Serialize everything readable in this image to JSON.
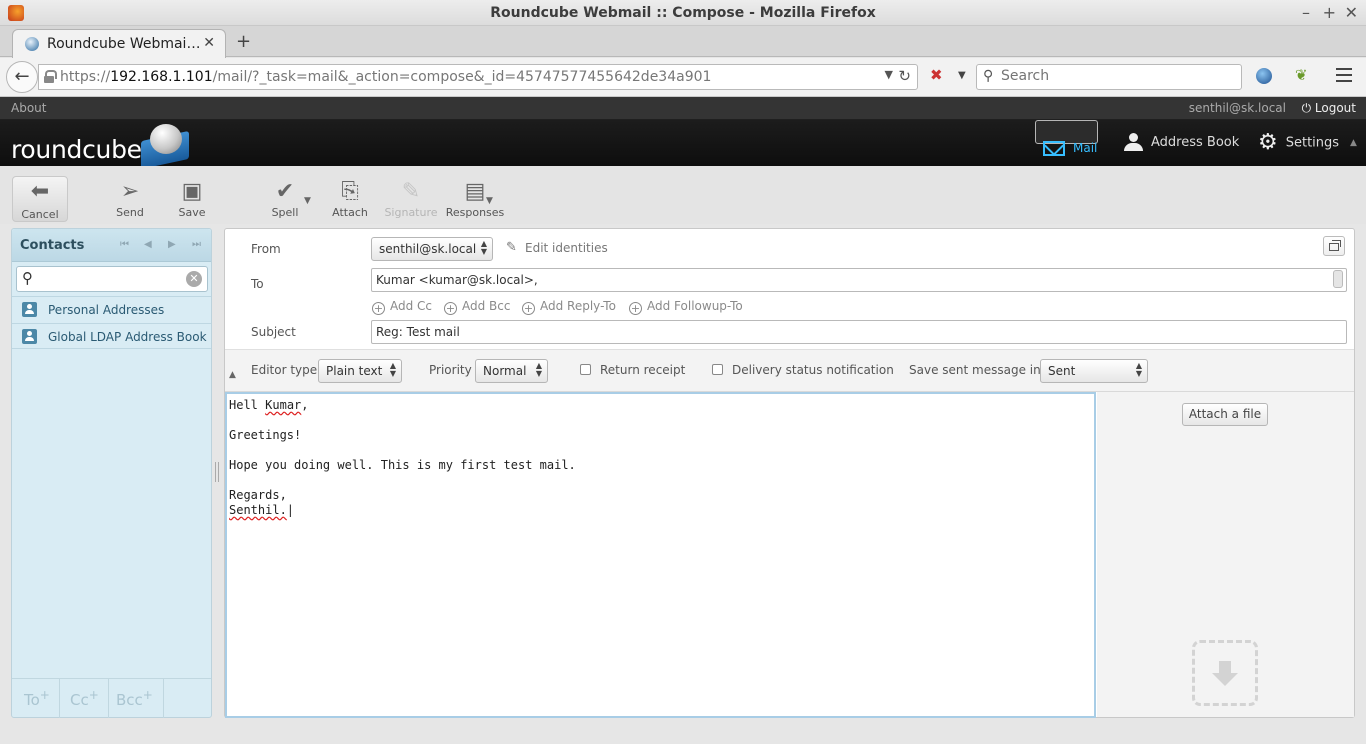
{
  "window": {
    "title": "Roundcube Webmail :: Compose - Mozilla Firefox"
  },
  "browser": {
    "tab_title": "Roundcube Webmai…",
    "url_prefix": "https://",
    "url_host": "192.168.1.101",
    "url_path": "/mail/?_task=mail&_action=compose&_id=45747577455642de34a901",
    "search_placeholder": "Search"
  },
  "topline": {
    "about": "About",
    "user": "senthil@sk.local",
    "logout": "Logout"
  },
  "header": {
    "logo_text": "roundcube",
    "nav": {
      "mail": "Mail",
      "address_book": "Address Book",
      "settings": "Settings"
    }
  },
  "toolbar": {
    "cancel": "Cancel",
    "send": "Send",
    "save": "Save",
    "spell": "Spell",
    "attach": "Attach",
    "signature": "Signature",
    "responses": "Responses"
  },
  "contacts": {
    "title": "Contacts",
    "address_books": [
      "Personal Addresses",
      "Global LDAP Address Book"
    ],
    "footer": {
      "to": "To",
      "cc": "Cc",
      "bcc": "Bcc"
    }
  },
  "compose": {
    "from_label": "From",
    "from_value": "senthil@sk.local",
    "edit_identities": "Edit identities",
    "to_label": "To",
    "to_value": "Kumar <kumar@sk.local>,",
    "add_cc": "Add Cc",
    "add_bcc": "Add Bcc",
    "add_reply_to": "Add Reply-To",
    "add_followup_to": "Add Followup-To",
    "subject_label": "Subject",
    "subject_value": "Reg: Test mail",
    "editor_type_label": "Editor type",
    "editor_type_value": "Plain text",
    "priority_label": "Priority",
    "priority_value": "Normal",
    "return_receipt": "Return receipt",
    "dsn": "Delivery status notification",
    "save_sent_label": "Save sent message in",
    "save_sent_value": "Sent",
    "body": {
      "greeting": "Hell",
      "name": "Kumar",
      "comma": ",",
      "line2": "Greetings!",
      "line3": "Hope you doing well. This is my first test mail.",
      "line4": "Regards,",
      "signature": "Senthil."
    },
    "attach_file": "Attach a file"
  }
}
